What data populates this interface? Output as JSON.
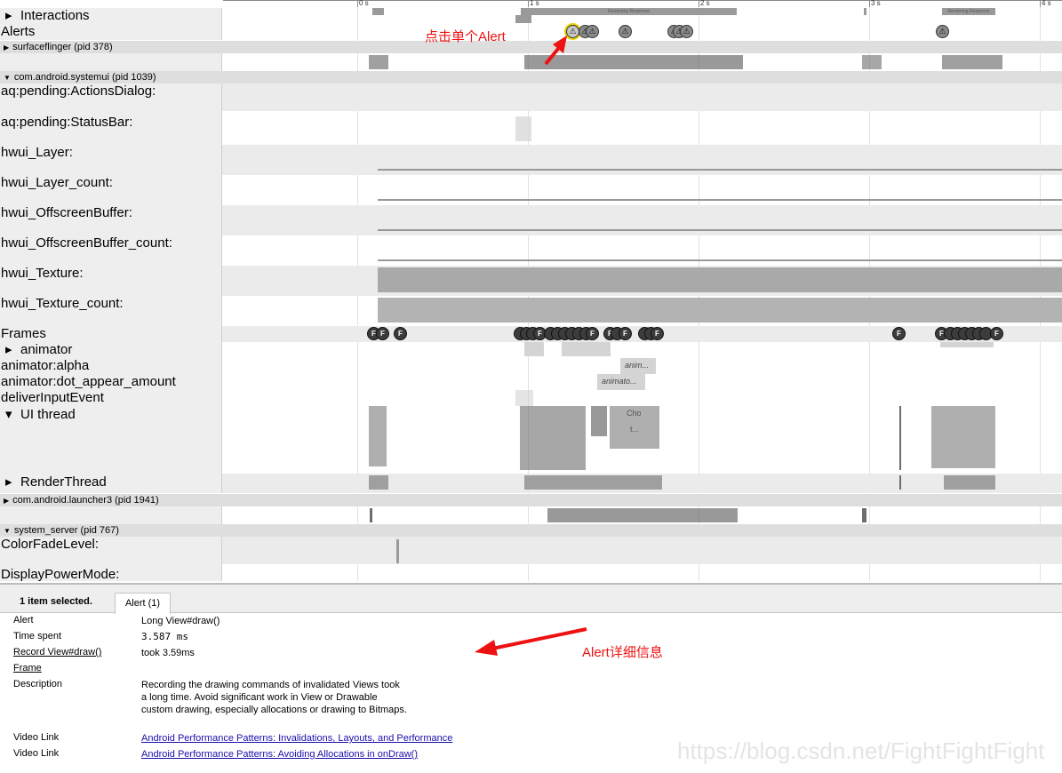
{
  "ruler": {
    "ticks": [
      "0 s",
      "1 s",
      "2 s",
      "3 s",
      "4 s"
    ]
  },
  "tracks": {
    "interactions": "Interactions",
    "alerts": "Alerts",
    "interaction_slice_1": "Rendering Response",
    "interaction_slice_2": "Rendering Response"
  },
  "processes": {
    "surfaceflinger": "surfaceflinger (pid 378)",
    "systemui": "com.android.systemui (pid 1039)",
    "launcher": "com.android.launcher3 (pid 1941)",
    "system_server": "system_server (pid 767)"
  },
  "systemui_tracks": {
    "actions_dialog": "aq:pending:ActionsDialog:",
    "status_bar": "aq:pending:StatusBar:",
    "hwui_layer": "hwui_Layer:",
    "hwui_layer_count": "hwui_Layer_count:",
    "hwui_offscreen": "hwui_OffscreenBuffer:",
    "hwui_offscreen_count": "hwui_OffscreenBuffer_count:",
    "hwui_texture": "hwui_Texture:",
    "hwui_texture_count": "hwui_Texture_count:",
    "frames": "Frames",
    "animator": "animator",
    "animator_alpha": "animator:alpha",
    "animator_dot": "animator:dot_appear_amount",
    "deliver_input": "deliverInputEvent",
    "ui_thread": "UI thread",
    "render_thread": "RenderThread"
  },
  "slice_labels": {
    "anim_short": "anim...",
    "animato": "animato...",
    "cho": "Cho",
    "t": "t..."
  },
  "system_server_tracks": {
    "color_fade": "ColorFadeLevel:",
    "display_power": "DisplayPowerMode:"
  },
  "icons": {
    "alert": "warning-triangle-icon",
    "frame_glyph": "F"
  },
  "annotations": {
    "click_alert": "点击单个Alert",
    "alert_detail": "Alert详细信息"
  },
  "panel": {
    "selection_count": "1 item selected.",
    "tab_label": "Alert (1)",
    "rows": [
      {
        "key": "Alert",
        "value": "Long View#draw()"
      },
      {
        "key": "Time spent",
        "value": "3.587 ms"
      },
      {
        "key": "Record View#draw()",
        "value": "took 3.59ms"
      },
      {
        "key": "Frame",
        "value": ""
      },
      {
        "key": "Description",
        "value": "Recording the drawing commands of invalidated Views took a long time. Avoid significant work in View or Drawable custom drawing, especially allocations or drawing to Bitmaps."
      },
      {
        "key": "Video Link",
        "value": "Android Performance Patterns: Invalidations, Layouts, and Performance"
      },
      {
        "key": "Video Link",
        "value": "Android Performance Patterns: Avoiding Allocations in onDraw()"
      }
    ]
  },
  "watermark": "https://blog.csdn.net/FightFightFight",
  "colors": {
    "accent_red": "#ee1111",
    "link_blue": "#1a0dab",
    "selected_ring": "#e8d400"
  }
}
